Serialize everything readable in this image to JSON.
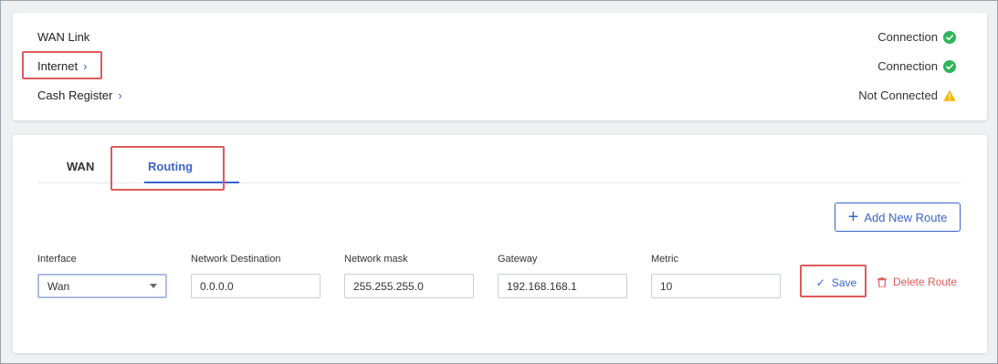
{
  "links": {
    "wan_link": "WAN Link",
    "internet": "Internet",
    "cash_register": "Cash Register"
  },
  "statuses": {
    "wan_link": "Connection",
    "internet": "Connection",
    "cash_register": "Not Connected"
  },
  "icons": {
    "connected": "check-circle-icon",
    "warning": "warning-triangle-icon",
    "chevron": "chevron-right-icon"
  },
  "tabs": {
    "wan": "WAN",
    "routing": "Routing"
  },
  "add_route_label": "Add New Route",
  "form": {
    "interface_label": "Interface",
    "interface_value": "Wan",
    "destination_label": "Network Destination",
    "destination_value": "0.0.0.0",
    "mask_label": "Network mask",
    "mask_value": "255.255.255.0",
    "gateway_label": "Gateway",
    "gateway_value": "192.168.168.1",
    "metric_label": "Metric",
    "metric_value": "10"
  },
  "save_label": "Save",
  "delete_label": "Delete Route",
  "colors": {
    "accent": "#3b63c9",
    "success": "#2fb65a",
    "warning": "#f4b400",
    "danger": "#e05a5a"
  }
}
